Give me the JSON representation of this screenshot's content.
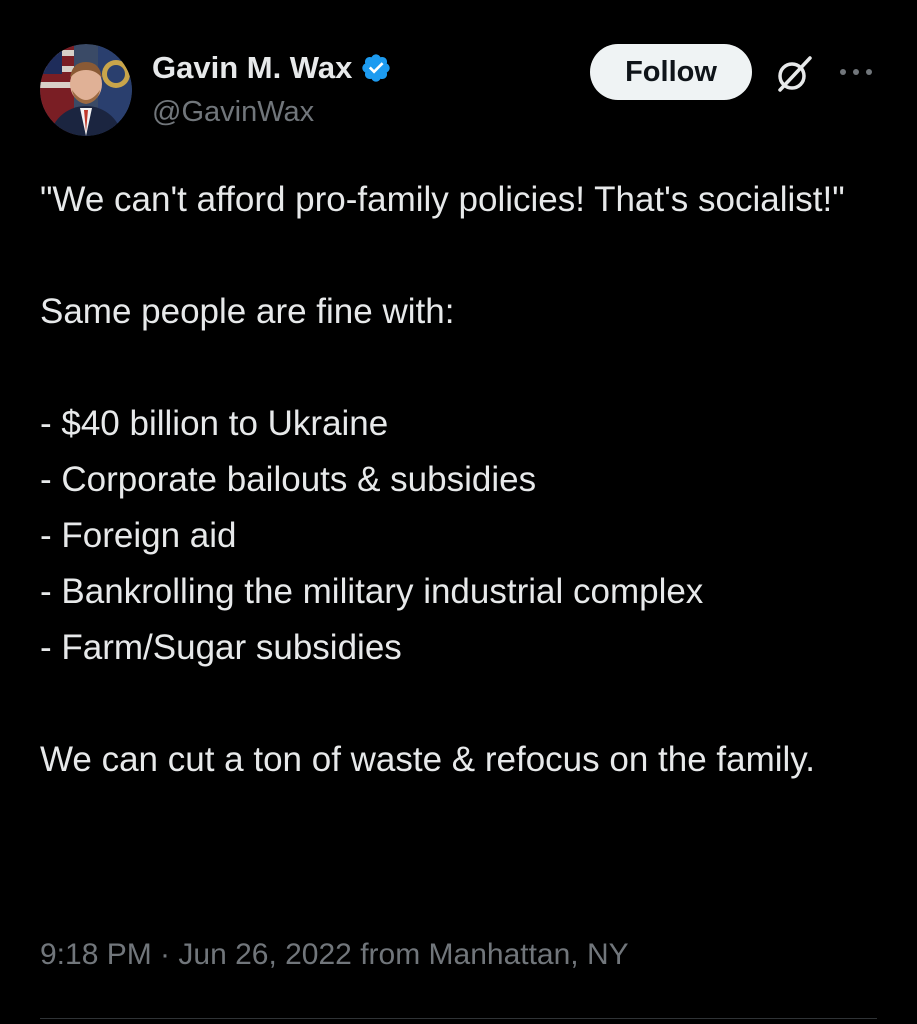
{
  "tweet": {
    "author": {
      "display_name": "Gavin M. Wax",
      "handle": "@GavinWax",
      "verified": true,
      "avatar_icon": "profile-photo"
    },
    "follow_label": "Follow",
    "paragraphs": [
      "\"We can't afford pro-family policies! That's socialist!\"",
      "Same people are fine with:",
      "- $40 billion to Ukraine\n- Corporate bailouts & subsidies\n- Foreign aid\n- Bankrolling the military industrial complex\n- Farm/Sugar subsidies",
      "We can cut a ton of waste & refocus on the family."
    ],
    "timestamp": "9:18 PM · Jun 26, 2022 from Manhattan, NY"
  },
  "icons": {
    "verified": "verified-badge-icon",
    "grok": "grok-icon",
    "more": "more-options-icon"
  },
  "colors": {
    "background": "#000000",
    "text_primary": "#e7e9ea",
    "text_secondary": "#71767b",
    "verified_blue": "#1d9bf0",
    "follow_bg": "#eff3f4",
    "follow_text": "#0f1419"
  }
}
